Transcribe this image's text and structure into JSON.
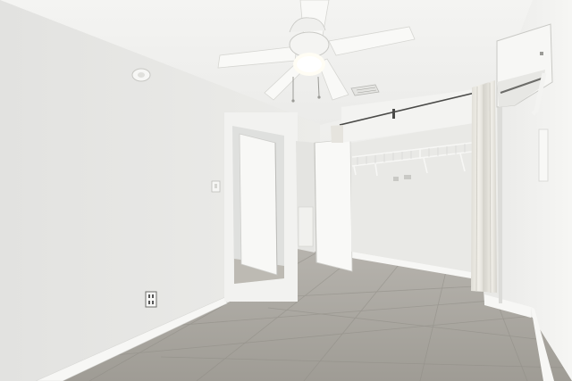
{
  "scene": {
    "type": "interior-photo",
    "subject": "empty bedroom",
    "objects": [
      "ceiling-fan",
      "ceiling-light",
      "smoke-detector",
      "ceiling-vent",
      "wall-mounted-ac-unit",
      "open-doorway",
      "interior-door",
      "closet",
      "closet-wire-shelf",
      "closet-curtain",
      "light-switch",
      "electrical-outlet",
      "thermostat",
      "baseboards",
      "tile-floor"
    ]
  },
  "colors": {
    "ceiling": "#f1f1ef",
    "left_wall": "#e7e7e5",
    "back_wall": "#eeeeec",
    "right_wall": "#f0f0ee",
    "floor": "#a9a69f",
    "trim": "#f6f6f4",
    "fan": "#f7f7f5",
    "curtain": "#eae8e2"
  }
}
